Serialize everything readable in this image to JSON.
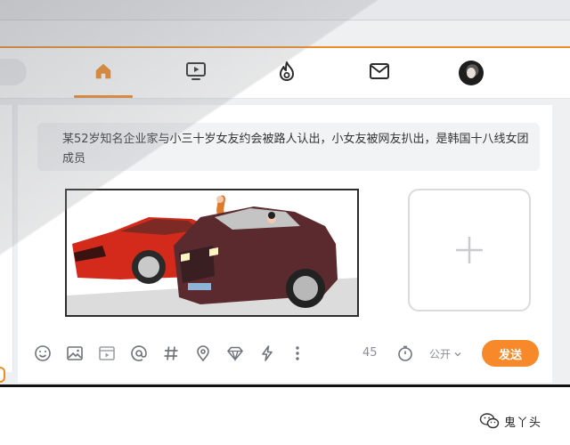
{
  "colors": {
    "accent": "#f08a24",
    "send_button": "#f7892b",
    "icon_gray": "#6f747a"
  },
  "nav": {
    "items": [
      {
        "id": "home",
        "icon": "home-icon",
        "active": true
      },
      {
        "id": "video",
        "icon": "video-play-icon",
        "active": false
      },
      {
        "id": "hot",
        "icon": "flame-icon",
        "active": false
      },
      {
        "id": "messages",
        "icon": "mail-icon",
        "active": false
      },
      {
        "id": "profile",
        "icon": "avatar",
        "active": false
      }
    ]
  },
  "composer": {
    "text": "某52岁知名企业家与小三十岁女友约会被路人认出，小女友被网友扒出，是韩国十八线女团成员",
    "image_alt": "漫画：红色跑车旁的女子与驾驶深色豪车的男子",
    "add_image_icon": "plus-icon",
    "char_count": "45",
    "visibility": "公开",
    "send_label": "发送",
    "tools": [
      "emoji-icon",
      "image-icon",
      "video-icon",
      "at-icon",
      "hashtag-icon",
      "location-icon",
      "diamond-icon",
      "lightning-icon",
      "more-icon"
    ],
    "timer_icon": "timer-icon"
  },
  "watermark": {
    "text": "鬼丫头",
    "icon": "wechat-icon"
  }
}
